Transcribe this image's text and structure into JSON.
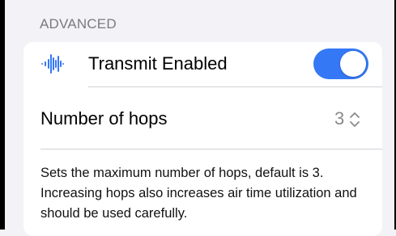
{
  "section": {
    "header": "ADVANCED"
  },
  "transmit": {
    "icon": "waveform-icon",
    "label": "Transmit Enabled",
    "enabled": true
  },
  "hops": {
    "label": "Number of hops",
    "value": "3",
    "icon": "chevron-up-down-icon"
  },
  "footer": {
    "description": "Sets the maximum number of hops, default is 3. Increasing hops also increases air time utilization and should be used carefully."
  },
  "colors": {
    "accent": "#3478f6",
    "background": "#f2f2f7",
    "card": "#ffffff",
    "secondary_text": "#8a8a8e"
  }
}
